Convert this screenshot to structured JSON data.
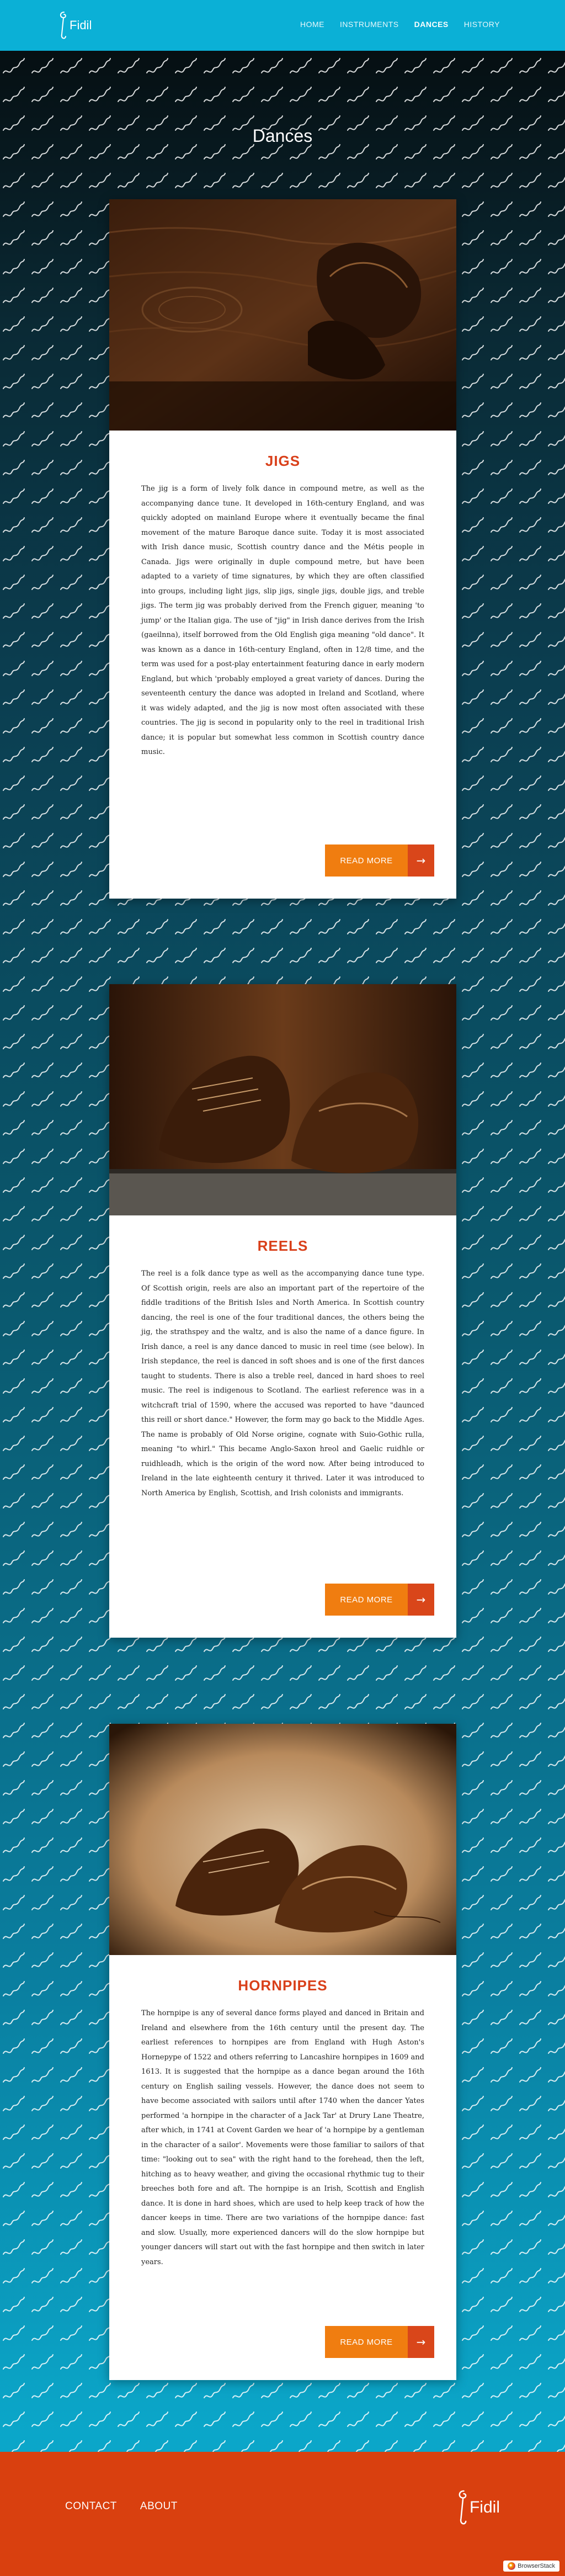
{
  "header": {
    "logo_text": "Fidil",
    "nav": [
      {
        "label": "HOME"
      },
      {
        "label": "INSTRUMENTS"
      },
      {
        "label": "DANCES"
      },
      {
        "label": "HISTORY"
      }
    ],
    "active_index": 2
  },
  "page": {
    "title": "Dances"
  },
  "dances": [
    {
      "title": "JIGS",
      "text": "The jig is a form of lively folk dance in compound metre, as well as the accompanying dance tune. It developed in 16th-century England, and was quickly adopted on mainland Europe where it eventually became the final movement of the mature Baroque dance suite. Today it is most associated with Irish dance music, Scottish country dance and the Métis people in Canada. Jigs were originally in duple compound metre, but have been adapted to a variety of time signatures, by which they are often classified into groups, including light jigs, slip jigs, single jigs, double jigs, and treble jigs. The term jig was probably derived from the French giguer, meaning 'to jump' or the Italian giga. The use of \"jig\" in Irish dance derives from the Irish (gaeilnna), itself borrowed from the Old English giga meaning \"old dance\". It was known as a dance in 16th-century England, often in 12/8 time, and the term was used for a post-play entertainment featuring dance in early modern England, but which 'probably employed a great variety of dances. During the seventeenth century the dance was adopted in Ireland and Scotland, where it was widely adapted, and the jig is now most often associated with these countries. The jig is second in popularity only to the reel in traditional Irish dance; it is popular but somewhat less common in Scottish country dance music.",
      "button": "READ MORE"
    },
    {
      "title": "REELS",
      "text": "The reel is a folk dance type as well as the accompanying dance tune type. Of Scottish origin, reels are also an important part of the repertoire of the fiddle traditions of the British Isles and North America. In Scottish country dancing, the reel is one of the four traditional dances, the others being the jig, the strathspey and the waltz, and is also the name of a dance figure. In Irish dance, a reel is any dance danced to music in reel time (see below). In Irish stepdance, the reel is danced in soft shoes and is one of the first dances taught to students. There is also a treble reel, danced in hard shoes to reel music. The reel is indigenous to Scotland. The earliest reference was in a witchcraft trial of 1590, where the accused was reported to have \"daunced this reill or short dance.\" However, the form may go back to the Middle Ages. The name is probably of Old Norse origine, cognate with Suio-Gothic rulla, meaning \"to whirl.\" This became Anglo-Saxon hreol and Gaelic ruidhle or ruidhleadh, which is the origin of the word now. After being introduced to Ireland in the late eighteenth century it thrived. Later it was introduced to North America by English, Scottish, and Irish colonists and immigrants.",
      "button": "READ MORE"
    },
    {
      "title": "HORNPIPES",
      "text": "The hornpipe is any of several dance forms played and danced in Britain and Ireland and elsewhere from the 16th century until the present day. The earliest references to hornpipes are from England with Hugh Aston's Hornepype of 1522 and others referring to Lancashire hornpipes in 1609 and 1613. It is suggested that the hornpipe as a dance began around the 16th century on English sailing vessels. However, the dance does not seem to have become associated with sailors until after 1740 when the dancer Yates performed 'a hornpipe in the character of a Jack Tar' at Drury Lane Theatre, after which, in 1741 at Covent Garden we hear of 'a hornpipe by a gentleman in the character of a sailor'. Movements were those familiar to sailors of that time: \"looking out to sea\" with the right hand to the forehead, then the left, hitching as to heavy weather, and giving the occasional rhythmic tug to their breeches both fore and aft. The hornpipe is an Irish, Scottish and English dance. It is done in hard shoes, which are used to help keep track of how the dancer keeps in time. There are two variations of the hornpipe dance: fast and slow. Usually, more experienced dancers will do the slow hornpipe but younger dancers will start out with the fast hornpipe and then switch in later years.",
      "button": "READ MORE"
    }
  ],
  "footer": {
    "links": [
      {
        "label": "CONTACT"
      },
      {
        "label": "ABOUT"
      }
    ],
    "logo_text": "Fidil"
  },
  "badge": {
    "label": "BrowserStack"
  },
  "colors": {
    "header_bg": "#0bb0d6",
    "accent_orange": "#f07d10",
    "accent_red": "#d9401a",
    "footer_bg": "#d9400f"
  },
  "icons": {
    "logo": "fiddle-scroll-icon",
    "button_arrow": "arrow-right-icon"
  }
}
